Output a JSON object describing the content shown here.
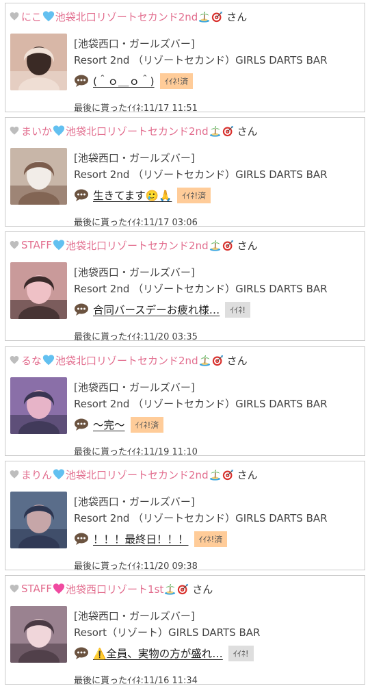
{
  "posts": [
    {
      "name": "にこ",
      "heart_color": "#62c0f0",
      "store": "池袋北口リゾートセカンド2nd",
      "suffix": "さん",
      "shop_line1": "[池袋西口・ガールズバー]",
      "shop_line2": "Resort 2nd （リゾートセカンド）GIRLS DARTS BAR",
      "message": "(＾ｏ＿ｏ＾)",
      "like_label": "ｲｲﾈ!済",
      "liked": true,
      "date_text": "最後に貰ったｲｲﾈ:11/17 11:51",
      "thumb_colors": [
        "#d8b7a7",
        "#3a2a25",
        "#f1e2d8"
      ]
    },
    {
      "name": "まいか",
      "heart_color": "#62c0f0",
      "store": "池袋北口リゾートセカンド2nd",
      "suffix": "さん",
      "shop_line1": "[池袋西口・ガールズバー]",
      "shop_line2": "Resort 2nd （リゾートセカンド）GIRLS DARTS BAR",
      "message": "生きてます🥲🙏",
      "like_label": "ｲｲﾈ!済",
      "liked": true,
      "date_text": "最後に貰ったｲｲﾈ:11/17 03:06",
      "thumb_colors": [
        "#c8b6a8",
        "#f2ede8",
        "#7b5c4c"
      ]
    },
    {
      "name": "STAFF",
      "heart_color": "#62c0f0",
      "store": "池袋北口リゾートセカンド2nd",
      "suffix": "さん",
      "shop_line1": "[池袋西口・ガールズバー]",
      "shop_line2": "Resort 2nd （リゾートセカンド）GIRLS DARTS BAR",
      "message": "合同バースデーお疲れ様…",
      "like_label": "ｲｲﾈ!",
      "liked": false,
      "date_text": "最後に貰ったｲｲﾈ:11/20 03:35",
      "thumb_colors": [
        "#c99a9a",
        "#efc1c6",
        "#3b2a2a"
      ]
    },
    {
      "name": "るな",
      "heart_color": "#62c0f0",
      "store": "池袋北口リゾートセカンド2nd",
      "suffix": "さん",
      "shop_line1": "[池袋西口・ガールズバー]",
      "shop_line2": "Resort 2nd （リゾートセカンド）GIRLS DARTS BAR",
      "message": "〜完〜",
      "like_label": "ｲｲﾈ!済",
      "liked": true,
      "date_text": "最後に貰ったｲｲﾈ:11/19 11:10",
      "thumb_colors": [
        "#8a6fa8",
        "#e7b4c8",
        "#3a3552"
      ]
    },
    {
      "name": "まりん",
      "heart_color": "#62c0f0",
      "store": "池袋北口リゾートセカンド2nd",
      "suffix": "さん",
      "shop_line1": "[池袋西口・ガールズバー]",
      "shop_line2": "Resort 2nd （リゾートセカンド）GIRLS DARTS BAR",
      "message": "！！！最終日！！！",
      "like_label": "ｲｲﾈ!済",
      "liked": true,
      "date_text": "最後に貰ったｲｲﾈ:11/20 09:38",
      "thumb_colors": [
        "#5a6d8a",
        "#c6a6a8",
        "#2c3550"
      ]
    },
    {
      "name": "STAFF",
      "heart_color": "#f04aa0",
      "store": "池袋西口リゾート1st",
      "suffix": "さん",
      "shop_line1": "[池袋西口・ガールズバー]",
      "shop_line2": "Resort（リゾート）GIRLS DARTS BAR",
      "message": "⚠️全員、実物の方が盛れ…",
      "like_label": "ｲｲﾈ!",
      "liked": false,
      "date_text": "最後に貰ったｲｲﾈ:11/16 11:34",
      "thumb_colors": [
        "#9a8290",
        "#f0d6da",
        "#4a3a44"
      ]
    }
  ],
  "icons": {
    "gray_heart": "gray-heart-icon",
    "store_emoji_1": "island-icon",
    "store_emoji_2": "dart-icon",
    "comment": "speech-bubble-icon"
  },
  "colors": {
    "name_pink": "#e26d8e",
    "like_done_bg": "#ffcc99",
    "like_bg": "#dedede",
    "border": "#c9c9c9"
  }
}
